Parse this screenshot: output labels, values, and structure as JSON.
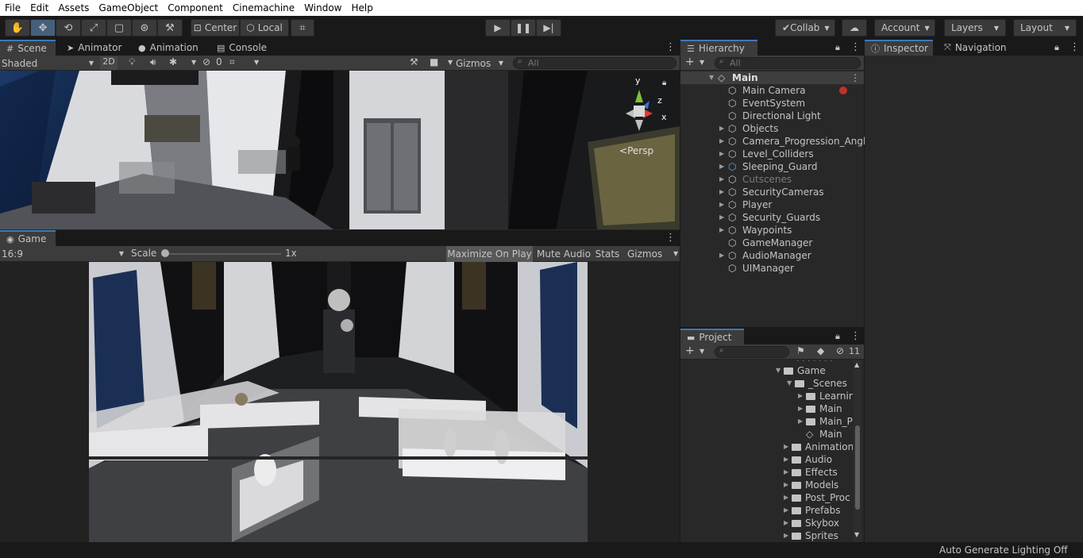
{
  "menu": [
    "File",
    "Edit",
    "Assets",
    "GameObject",
    "Component",
    "Cinemachine",
    "Window",
    "Help"
  ],
  "toolbar": {
    "pivot_label": "Center",
    "space_label": "Local",
    "collab_label": "Collab",
    "account_label": "Account",
    "layers_label": "Layers",
    "layout_label": "Layout"
  },
  "scene_panel": {
    "tabs": [
      "Scene",
      "Animator",
      "Animation",
      "Console"
    ],
    "draw_mode": "Shaded",
    "mode_2d": "2D",
    "hidden_count": "0",
    "gizmos_label": "Gizmos",
    "search_placeholder": "All",
    "gizmo_axis_y": "y",
    "gizmo_axis_x": "x",
    "gizmo_axis_z": "z",
    "persp_label": "Persp"
  },
  "game_panel": {
    "tab": "Game",
    "aspect": "16:9",
    "scale_label": "Scale",
    "scale_value": "1x",
    "maximize_label": "Maximize On Play",
    "mute_label": "Mute Audio",
    "stats_label": "Stats",
    "gizmos_label": "Gizmos"
  },
  "hierarchy": {
    "tab": "Hierarchy",
    "search_placeholder": "All",
    "scene_name": "Main",
    "items": [
      {
        "label": "Main Camera",
        "expandable": false
      },
      {
        "label": "EventSystem",
        "expandable": false
      },
      {
        "label": "Directional Light",
        "expandable": false
      },
      {
        "label": "Objects",
        "expandable": true
      },
      {
        "label": "Camera_Progression_Angle",
        "expandable": true
      },
      {
        "label": "Level_Colliders",
        "expandable": true
      },
      {
        "label": "Sleeping_Guard",
        "expandable": true
      },
      {
        "label": "Cutscenes",
        "expandable": true
      },
      {
        "label": "SecurityCameras",
        "expandable": true
      },
      {
        "label": "Player",
        "expandable": true
      },
      {
        "label": "Security_Guards",
        "expandable": true
      },
      {
        "label": "Waypoints",
        "expandable": true
      },
      {
        "label": "GameManager",
        "expandable": false
      },
      {
        "label": "AudioManager",
        "expandable": true
      },
      {
        "label": "UIManager",
        "expandable": false
      }
    ]
  },
  "project": {
    "tab": "Project",
    "hidden_count": "11",
    "items": [
      {
        "label": "Game"
      },
      {
        "label": "_Scenes"
      },
      {
        "label": "Learnin"
      },
      {
        "label": "Main"
      },
      {
        "label": "Main_P"
      },
      {
        "label": "Main"
      },
      {
        "label": "Animation"
      },
      {
        "label": "Audio"
      },
      {
        "label": "Effects"
      },
      {
        "label": "Models"
      },
      {
        "label": "Post_Proc"
      },
      {
        "label": "Prefabs"
      },
      {
        "label": "Skybox"
      },
      {
        "label": "Sprites"
      }
    ]
  },
  "inspector": {
    "tabs": [
      "Inspector",
      "Navigation"
    ]
  },
  "status": {
    "lighting": "Auto Generate Lighting Off"
  },
  "colors": {
    "accent": "#3a79bb",
    "panel_bg": "#282828",
    "toolbar_bg": "#191919"
  }
}
